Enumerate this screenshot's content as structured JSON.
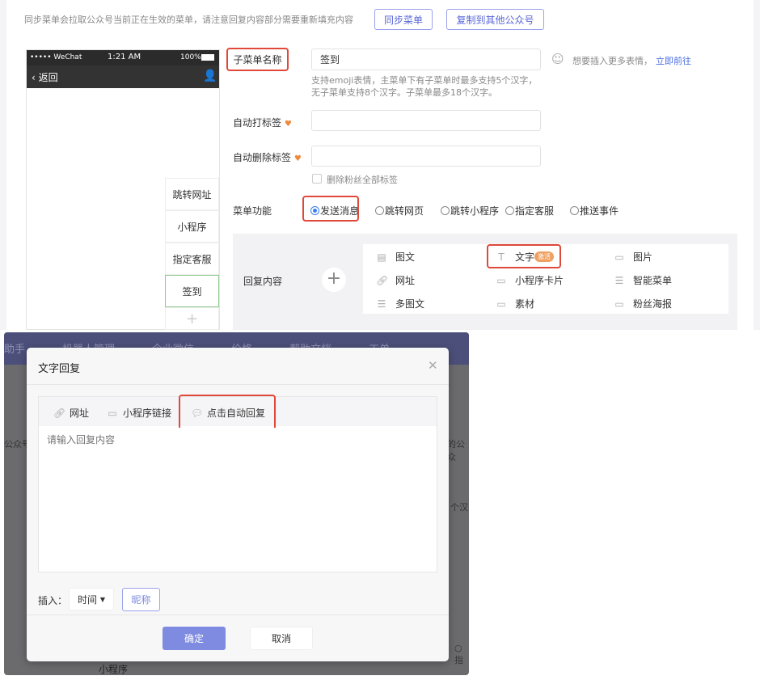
{
  "top": {
    "sync_hint": "同步菜单会拉取公众号当前正在生效的菜单，请注意回复内容部分需要重新填充内容",
    "sync_button": "同步菜单",
    "copy_button": "复制到其他公众号",
    "phone": {
      "carrier": "••••• WeChat",
      "time": "1:21 AM",
      "battery": "100%",
      "back": "返回",
      "submenu": [
        "跳转网址",
        "小程序",
        "指定客服",
        "签到"
      ],
      "add": "+"
    },
    "form": {
      "name_label": "子菜单名称",
      "name_value": "签到",
      "emoji_hint": "想要插入更多表情，",
      "emoji_link": "立即前往",
      "name_help_1": "支持emoji表情，主菜单下有子菜单时最多支持5个汉字，",
      "name_help_2": "无子菜单支持8个汉字。子菜单最多18个汉字。",
      "tag_label": "自动打标签",
      "untag_label": "自动删除标签",
      "remove_all_tags": "删除粉丝全部标签",
      "function_label": "菜单功能",
      "functions": [
        "发送消息",
        "跳转网页",
        "跳转小程序",
        "指定客服",
        "推送事件"
      ],
      "selected_function": "发送消息",
      "reply_label": "回复内容",
      "reply_types": [
        {
          "label": "图文",
          "icon": "article-icon"
        },
        {
          "label": "文字",
          "icon": "text-icon",
          "badge": "激活"
        },
        {
          "label": "图片",
          "icon": "image-icon"
        },
        {
          "label": "网址",
          "icon": "link-icon"
        },
        {
          "label": "小程序卡片",
          "icon": "miniprogram-card-icon"
        },
        {
          "label": "智能菜单",
          "icon": "list-icon"
        },
        {
          "label": "多图文",
          "icon": "list-icon"
        },
        {
          "label": "素材",
          "icon": "material-icon"
        },
        {
          "label": "粉丝海报",
          "icon": "poster-icon"
        }
      ]
    }
  },
  "background_nav": [
    "助手",
    "机器人管理",
    "企业微信",
    "价格",
    "帮助文档",
    "工单"
  ],
  "background_fragments": {
    "a": "公众号",
    "b": "的公众",
    "c": "个汉",
    "d": "○指",
    "e": "小程序"
  },
  "modal": {
    "title": "文字回复",
    "toolbar": [
      "网址",
      "小程序链接",
      "点击自动回复"
    ],
    "placeholder": "请输入回复内容",
    "insert_label": "插入：",
    "insert_time": "时间",
    "insert_nickname": "昵称",
    "confirm": "确定",
    "cancel": "取消"
  },
  "colors": {
    "accent": "#7f8be0",
    "highlight": "#e0483a",
    "selected_green": "#8cc98c",
    "badge": "#f0a060"
  }
}
